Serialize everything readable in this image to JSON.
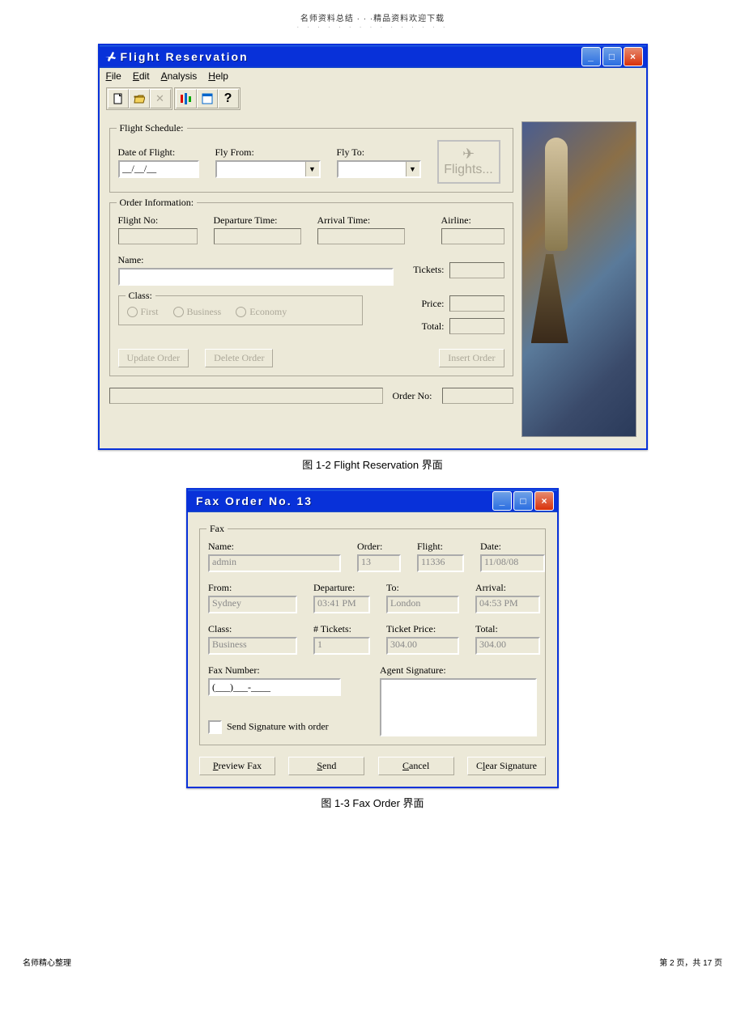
{
  "page_header": "名师资料总结 · · ·精品资料欢迎下载",
  "dots": "· · · · · · · · · · · · · · ·",
  "footer_left": "名师精心整理",
  "footer_right": "第 2 页，共 17 页",
  "caption1": "图 1-2    Flight Reservation   界面",
  "caption2": "图 1-3    Fax Order  界面",
  "win1": {
    "title": "Flight Reservation",
    "menu": {
      "file": "File",
      "edit": "Edit",
      "analysis": "Analysis",
      "help": "Help"
    },
    "toolbar_tips": {
      "new": "new",
      "open": "open",
      "delete": "x",
      "chart": "chart",
      "form": "form",
      "help": "?"
    },
    "flight_schedule": {
      "legend": "Flight Schedule:",
      "date_lbl": "Date of Flight:",
      "date_val": "__/__/__",
      "from_lbl": "Fly From:",
      "to_lbl": "Fly To:",
      "flights_btn": "Flights..."
    },
    "order_info": {
      "legend": "Order Information:",
      "flight_no": "Flight No:",
      "dep_time": "Departure Time:",
      "arr_time": "Arrival Time:",
      "airline": "Airline:",
      "name": "Name:",
      "tickets": "Tickets:",
      "class": {
        "legend": "Class:",
        "first": "First",
        "business": "Business",
        "economy": "Economy"
      },
      "price": "Price:",
      "total": "Total:",
      "update": "Update Order",
      "delete": "Delete Order",
      "insert": "Insert Order"
    },
    "order_no": "Order No:"
  },
  "win2": {
    "title": "Fax Order No. 13",
    "fax": {
      "legend": "Fax",
      "name_lbl": "Name:",
      "name_val": "admin",
      "order_lbl": "Order:",
      "order_val": "13",
      "flight_lbl": "Flight:",
      "flight_val": "11336",
      "date_lbl": "Date:",
      "date_val": "11/08/08",
      "from_lbl": "From:",
      "from_val": "Sydney",
      "dep_lbl": "Departure:",
      "dep_val": "03:41 PM",
      "to_lbl": "To:",
      "to_val": "London",
      "arr_lbl": "Arrival:",
      "arr_val": "04:53 PM",
      "class_lbl": "Class:",
      "class_val": "Business",
      "tickets_lbl": "# Tickets:",
      "tickets_val": "1",
      "price_lbl": "Ticket Price:",
      "price_val": "304.00",
      "total_lbl": "Total:",
      "total_val": "304.00",
      "faxnum_lbl": "Fax Number:",
      "faxnum_val": "(___)___-____",
      "sig_lbl": "Agent Signature:",
      "send_sig": "Send Signature with order"
    },
    "btns": {
      "preview": "Preview Fax",
      "send": "Send",
      "cancel": "Cancel",
      "clear": "Clear Signature"
    }
  }
}
